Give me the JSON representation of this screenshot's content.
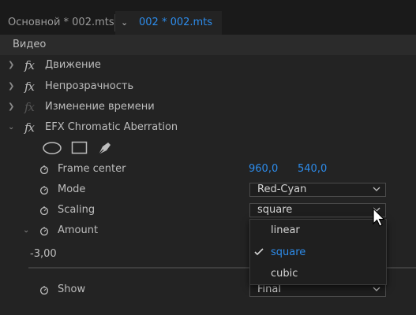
{
  "tabs": {
    "source_tab": "Основной * 002.mts",
    "active_tab": "002 * 002.mts"
  },
  "section": {
    "title": "Видео"
  },
  "effects": [
    {
      "label": "Движение"
    },
    {
      "label": "Непрозрачность"
    },
    {
      "label": "Изменение времени"
    },
    {
      "label": "EFX Chromatic Aberration"
    }
  ],
  "params": {
    "frame_center": {
      "label": "Frame center",
      "x": "960,0",
      "y": "540,0"
    },
    "mode": {
      "label": "Mode",
      "value": "Red-Cyan"
    },
    "scaling": {
      "label": "Scaling",
      "value": "square"
    },
    "amount": {
      "label": "Amount",
      "value": "-3,00"
    },
    "show": {
      "label": "Show",
      "value": "Final"
    }
  },
  "scaling_menu": {
    "options": [
      "linear",
      "square",
      "cubic"
    ],
    "selected": "square"
  },
  "colors": {
    "accent": "#2d8ceb",
    "background": "#232323",
    "tabbar": "#1a1a1a"
  },
  "icons": [
    "fx-icon",
    "stopwatch-icon",
    "ellipse-mask-icon",
    "rectangle-mask-icon",
    "pen-mask-icon",
    "chevron-down-icon",
    "checkmark-icon",
    "mouse-cursor-icon"
  ]
}
